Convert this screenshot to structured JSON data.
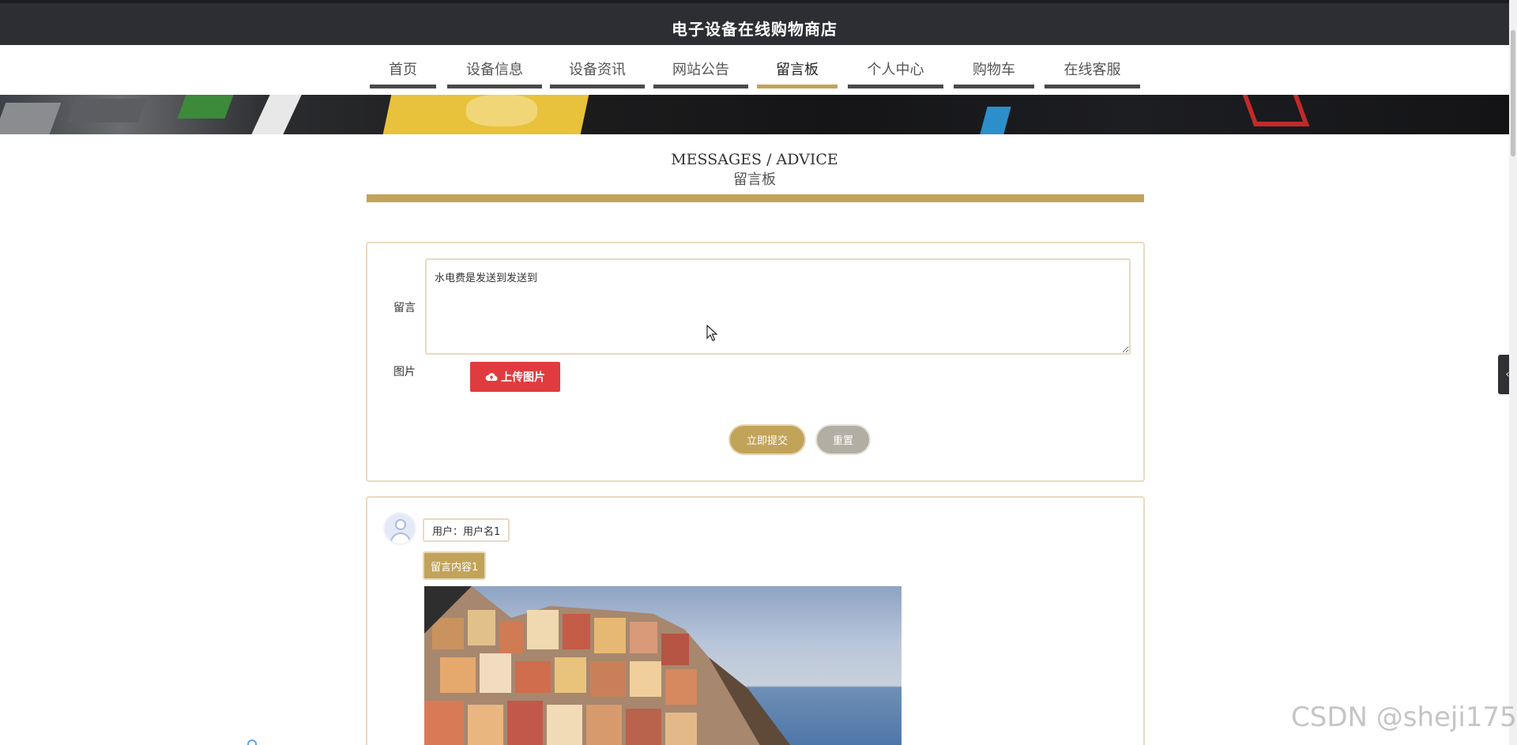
{
  "header": {
    "site_title": "电子设备在线购物商店"
  },
  "nav": {
    "items": [
      {
        "label": "首页",
        "active": false
      },
      {
        "label": "设备信息",
        "active": false
      },
      {
        "label": "设备资讯",
        "active": false
      },
      {
        "label": "网站公告",
        "active": false
      },
      {
        "label": "留言板",
        "active": true
      },
      {
        "label": "个人中心",
        "active": false
      },
      {
        "label": "购物车",
        "active": false
      },
      {
        "label": "在线客服",
        "active": false
      }
    ]
  },
  "section": {
    "title_en": "MESSAGES / ADVICE",
    "title_zh": "留言板"
  },
  "form": {
    "message_label": "留言",
    "message_value": "水电费是发送到发送到",
    "image_label": "图片",
    "upload_label": "上传图片",
    "submit_label": "立即提交",
    "reset_label": "重置"
  },
  "messages": [
    {
      "user": "用户：用户名1",
      "content": "留言内容1"
    }
  ],
  "watermark": "CSDN @sheji175",
  "colors": {
    "accent": "#c2a35a",
    "header_bg": "#2d2e33",
    "upload": "#e03c3f",
    "reset": "#b3aea3"
  },
  "icons": {
    "upload": "cloud-upload-icon",
    "side_tab": "chevron-left-icon",
    "avatar": "user-avatar-icon"
  }
}
